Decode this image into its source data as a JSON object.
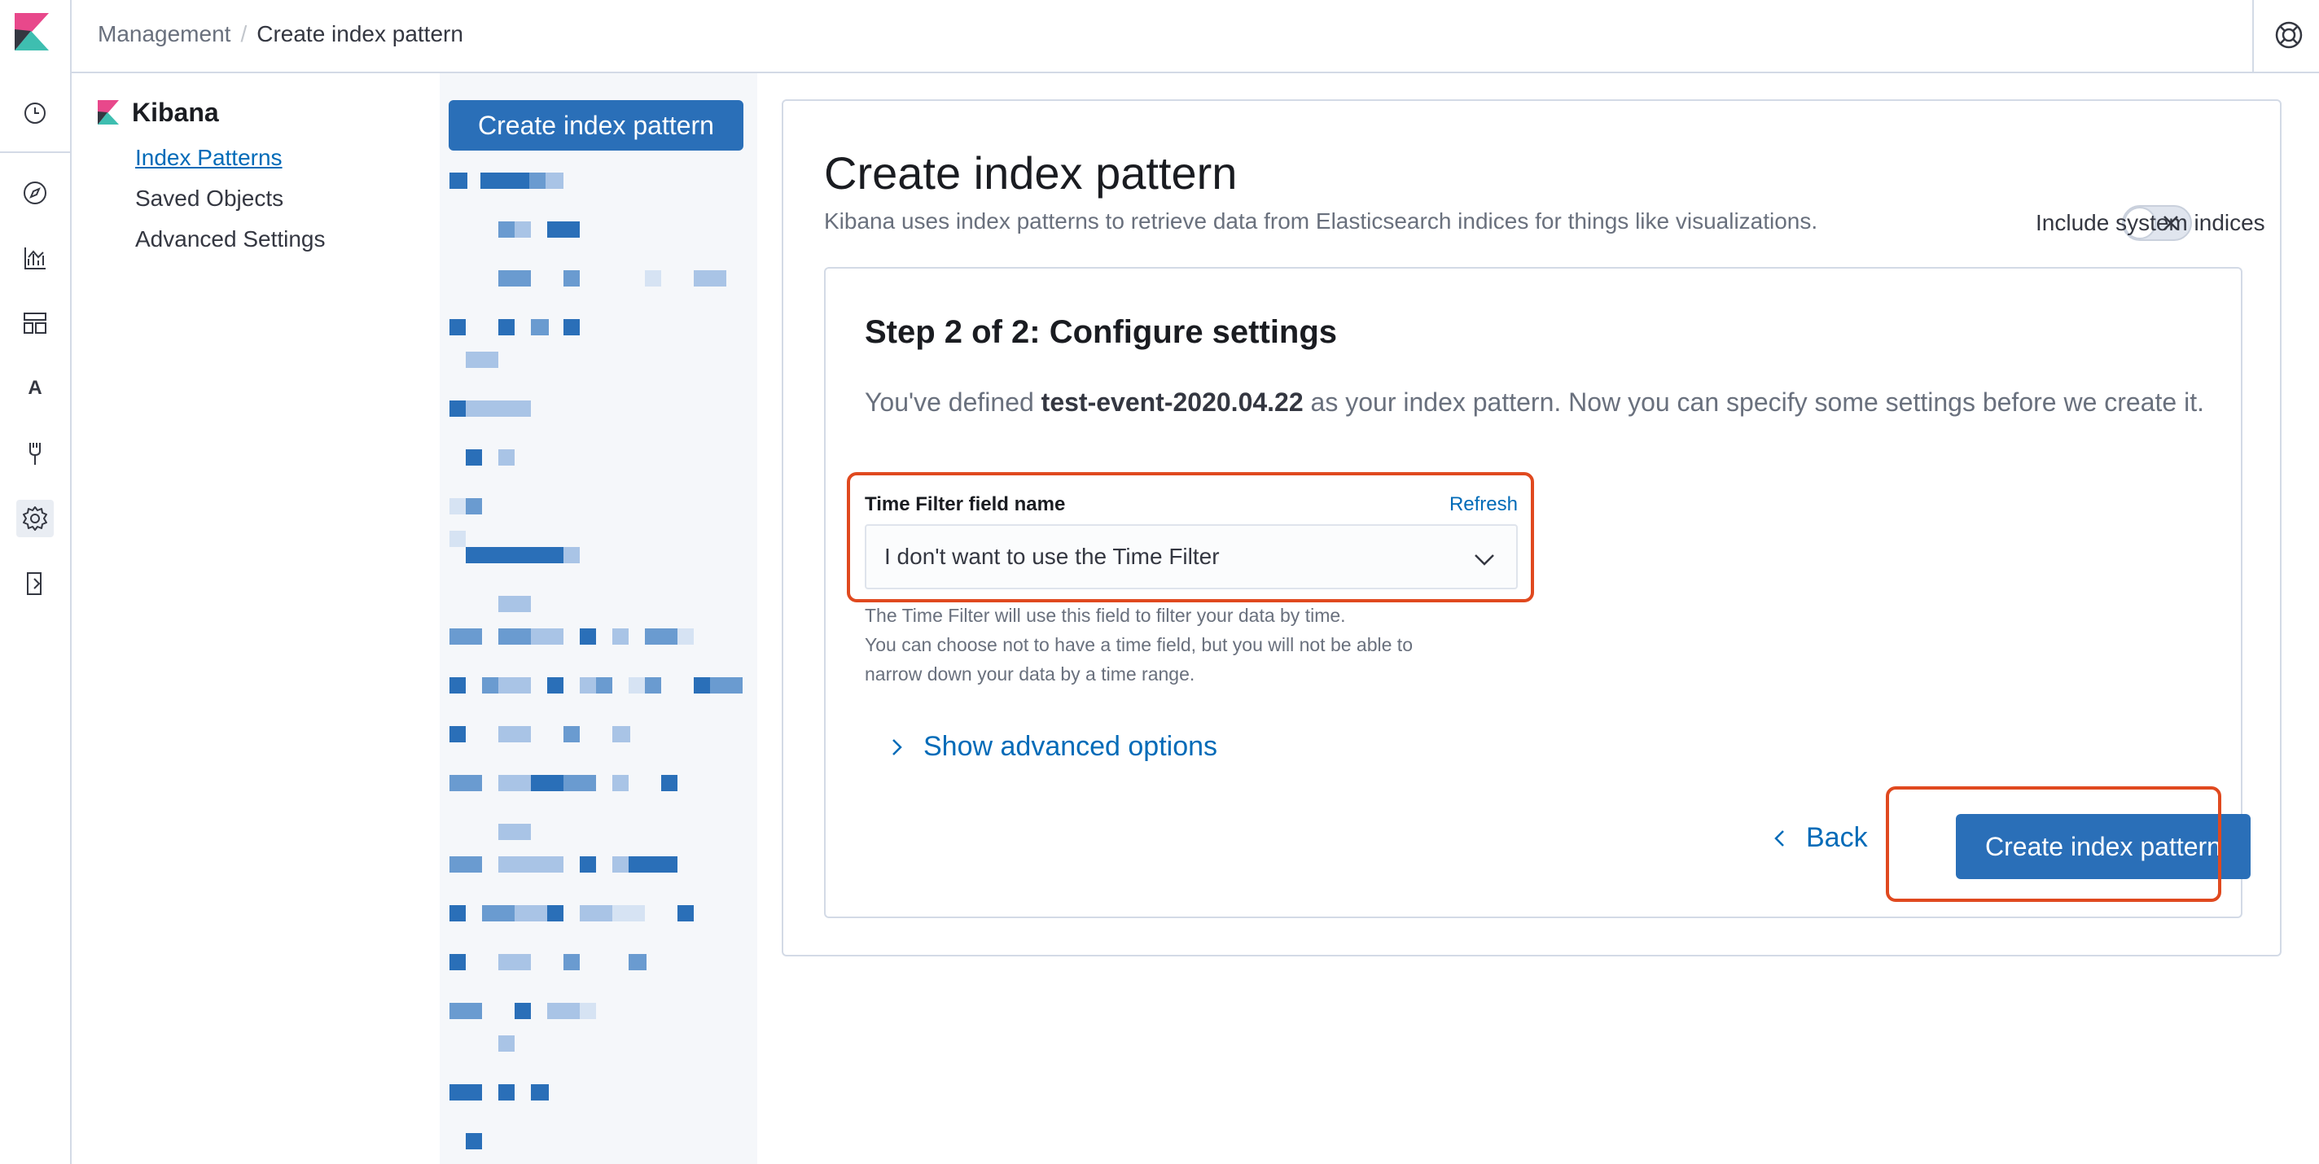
{
  "app": {
    "rail_items": [
      {
        "name": "recently-viewed-icon"
      },
      {
        "name": "discover-icon"
      },
      {
        "name": "visualize-icon"
      },
      {
        "name": "dashboard-icon"
      },
      {
        "name": "apm-letter-icon",
        "letter": "A"
      },
      {
        "name": "dev-tools-icon"
      },
      {
        "name": "management-gear-icon"
      },
      {
        "name": "logout-icon"
      }
    ]
  },
  "header": {
    "breadcrumb_parent": "Management",
    "breadcrumb_current": "Create index pattern"
  },
  "sidebar": {
    "title": "Kibana",
    "items": [
      {
        "label": "Index Patterns",
        "active": true
      },
      {
        "label": "Saved Objects",
        "active": false
      },
      {
        "label": "Advanced Settings",
        "active": false
      }
    ]
  },
  "pattern_list": {
    "create_button_label": "Create index pattern"
  },
  "main": {
    "title": "Create index pattern",
    "subtitle": "Kibana uses index patterns to retrieve data from Elasticsearch indices for things like visualizations.",
    "system_indices_label": "Include system indices",
    "system_indices_on": false,
    "step": {
      "title": "Step 2 of 2: Configure settings",
      "desc_prefix": "You've defined ",
      "desc_pattern": "test-event-2020.04.22",
      "desc_suffix": " as your index pattern. Now you can specify some settings before we create it.",
      "time_field_label": "Time Filter field name",
      "refresh_label": "Refresh",
      "time_field_value": "I don't want to use the Time Filter",
      "help_lines": [
        "The Time Filter will use this field to filter your data by time.",
        "You can choose not to have a time field, but you will not be able to",
        "narrow down your data by a time range."
      ],
      "advanced_label": "Show advanced options",
      "back_label": "Back",
      "create_label": "Create index pattern"
    }
  },
  "colors": {
    "primary": "#2a6fb8",
    "link": "#006bb8",
    "highlight": "#e0491f",
    "border": "#d3dae6"
  }
}
